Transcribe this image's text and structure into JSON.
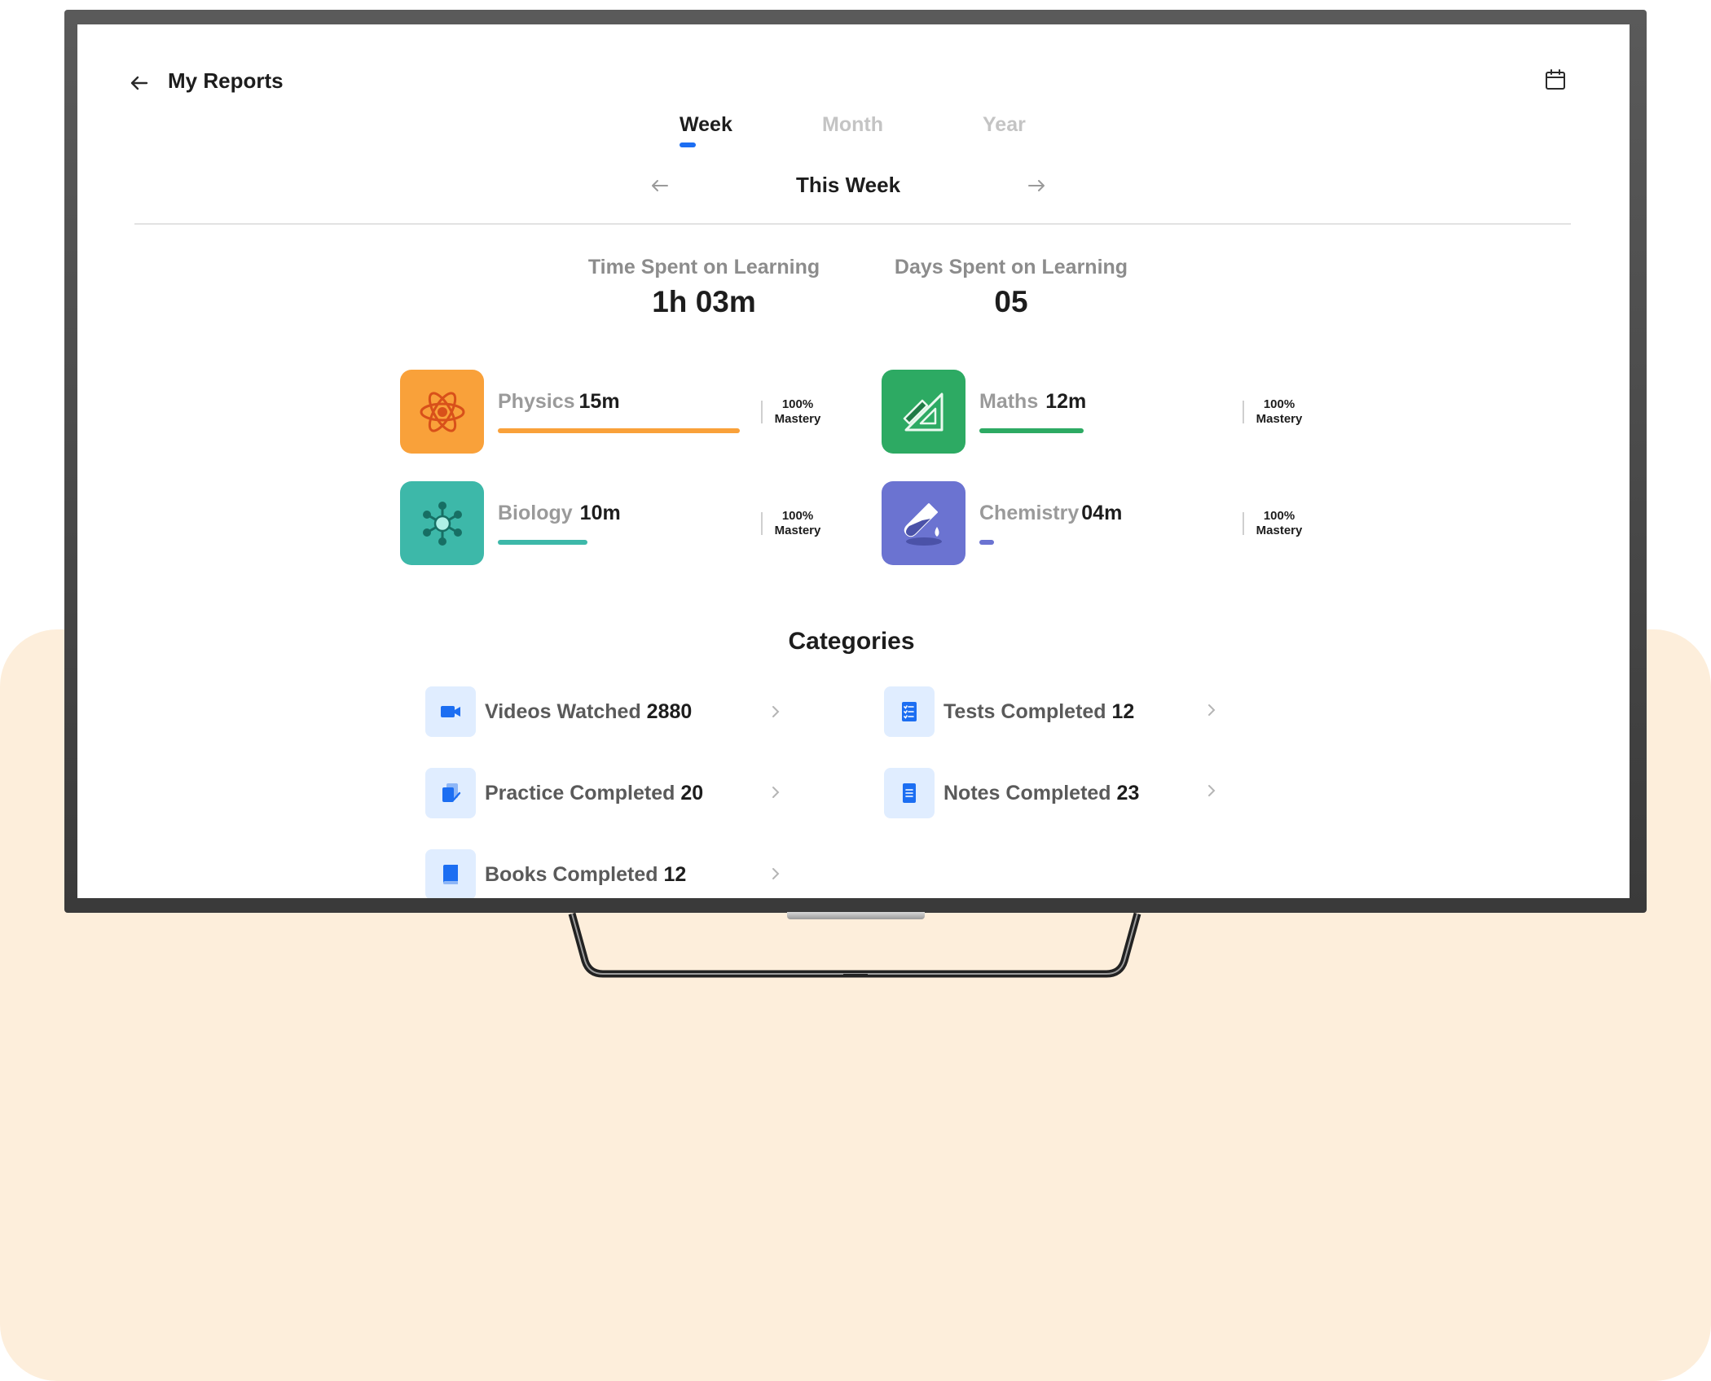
{
  "header": {
    "title": "My Reports"
  },
  "tabs": [
    {
      "label": "Week",
      "active": true
    },
    {
      "label": "Month",
      "active": false
    },
    {
      "label": "Year",
      "active": false
    }
  ],
  "period": {
    "label": "This Week"
  },
  "stats": [
    {
      "label": "Time Spent on Learning",
      "value": "1h 03m"
    },
    {
      "label": "Days Spent on Learning",
      "value": "05"
    }
  ],
  "subjects": [
    {
      "name": "Physics",
      "time": "15m",
      "mastery_value": "100%",
      "mastery_label": "Mastery",
      "color": "#f9a13a",
      "progress": 1.0,
      "icon": "atom-icon"
    },
    {
      "name": "Maths",
      "time": "12m",
      "mastery_value": "100%",
      "mastery_label": "Mastery",
      "color": "#2daa63",
      "progress": 0.43,
      "icon": "set-square-icon"
    },
    {
      "name": "Biology",
      "time": "10m",
      "mastery_value": "100%",
      "mastery_label": "Mastery",
      "color": "#3db8a9",
      "progress": 0.37,
      "icon": "molecule-icon"
    },
    {
      "name": "Chemistry",
      "time": "04m",
      "mastery_value": "100%",
      "mastery_label": "Mastery",
      "color": "#6b73d1",
      "progress": 0.06,
      "icon": "test-tube-icon"
    }
  ],
  "categories_title": "Categories",
  "categories": [
    {
      "label": "Videos Watched",
      "count": "2880",
      "icon": "video-camera-icon"
    },
    {
      "label": "Tests Completed",
      "count": "12",
      "icon": "checklist-icon"
    },
    {
      "label": "Practice Completed",
      "count": "20",
      "icon": "practice-icon"
    },
    {
      "label": "Notes Completed",
      "count": "23",
      "icon": "note-icon"
    },
    {
      "label": "Books Completed",
      "count": "12",
      "icon": "book-icon"
    }
  ],
  "colors": {
    "accent": "#1c6ef2",
    "category_icon_bg": "#e0edff",
    "page_background": "#fdeedb"
  }
}
